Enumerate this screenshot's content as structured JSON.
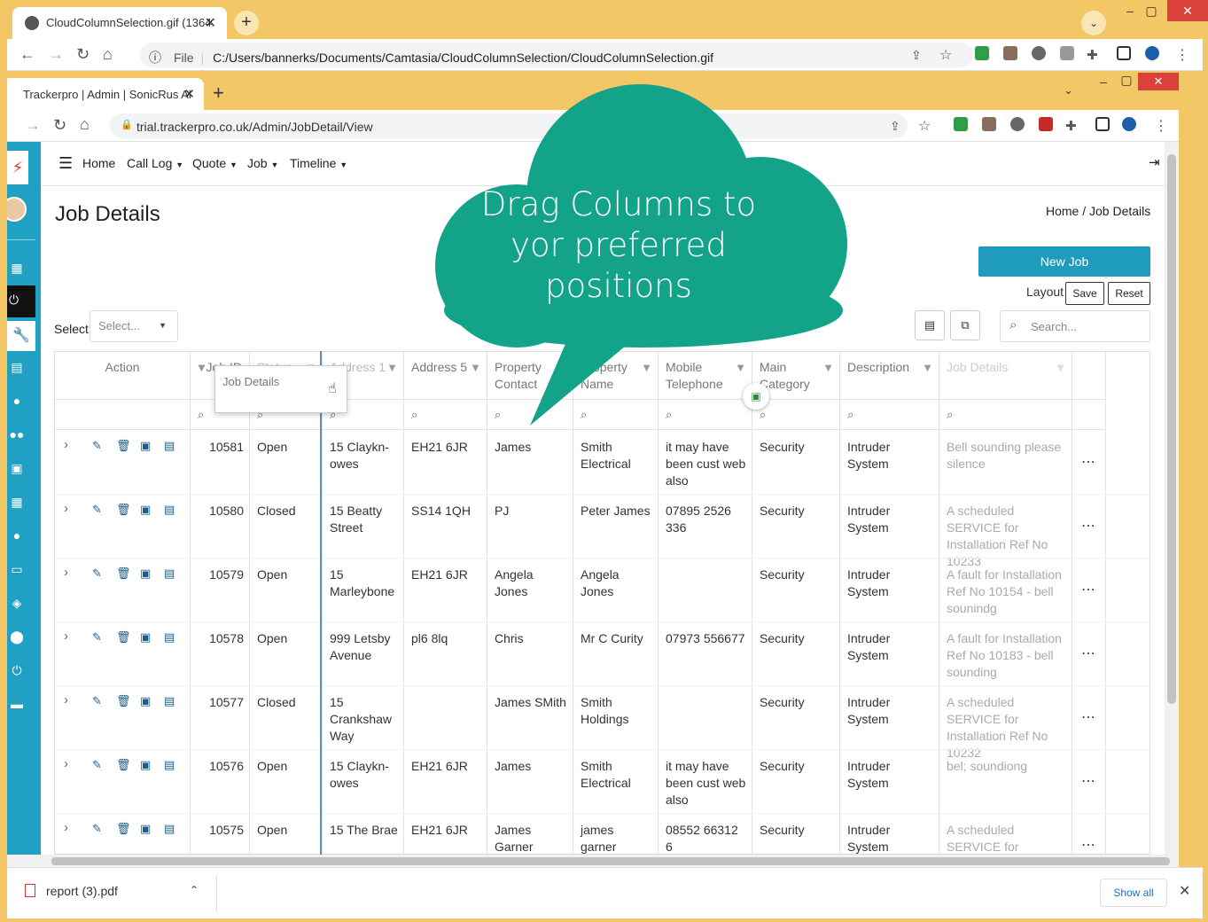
{
  "outer_browser": {
    "tab_title": "CloudColumnSelection.gif (1364",
    "file_label": "File",
    "url": "C:/Users/bannerks/Documents/Camtasia/CloudColumnSelection/CloudColumnSelection.gif"
  },
  "inner_browser": {
    "tab_title": "Trackerpro | Admin | SonicRus Al",
    "url": "trial.trackerpro.co.uk/Admin/JobDetail/View"
  },
  "nav": {
    "home": "Home",
    "call_log": "Call Log",
    "quote": "Quote",
    "job": "Job",
    "timeline": "Timeline"
  },
  "page": {
    "title": "Job Details",
    "breadcrumb": "Home  /  Job Details",
    "new_job": "New Job",
    "layout_label": "Layout",
    "save": "Save",
    "reset": "Reset",
    "select_label": "Select",
    "select_placeholder": "Select...",
    "search_placeholder": "Search..."
  },
  "callout": "Drag Columns to yor preferred positions",
  "drag_ghost": "Job Details",
  "headers": {
    "action": "Action",
    "job_id": "Job ID",
    "status": "Status",
    "address1": "Address 1",
    "address5": "Address 5",
    "property_contact": "Property Contact",
    "property_name": "Property Name",
    "mobile": "Mobile Telephone",
    "main_category": "Main Category",
    "description": "Description",
    "job_details": "Job Details"
  },
  "rows": [
    {
      "id": "10581",
      "status": "Open",
      "address1": "15 Claykn­owes",
      "address5": "EH21 6JR",
      "contact": "James",
      "name": "Smith Electrical",
      "mobile": "it may have been cust web also",
      "category": "Security",
      "description": "Intruder System",
      "details": "Bell sounding please silence"
    },
    {
      "id": "10580",
      "status": "Closed",
      "address1": "15 Beatty Street",
      "address5": "SS14 1QH",
      "contact": "PJ",
      "name": "Peter James",
      "mobile": "07895 2526 336",
      "category": "Security",
      "description": "Intruder System",
      "details": "A scheduled SERVICE for Installation Ref No 10233"
    },
    {
      "id": "10579",
      "status": "Open",
      "address1": "15 Marleybone",
      "address5": "EH21 6JR",
      "contact": "Angela Jones",
      "name": "Angela Jones",
      "mobile": "",
      "category": "Security",
      "description": "Intruder System",
      "details": "A fault for Installation Ref No 10154 - bell sounindg"
    },
    {
      "id": "10578",
      "status": "Open",
      "address1": "999 Letsby Avenue",
      "address5": "pl6 8lq",
      "contact": "Chris",
      "name": "Mr C Curity",
      "mobile": "07973 556677",
      "category": "Security",
      "description": "Intruder System",
      "details": "A fault for Installation Ref No 10183 - bell sounding"
    },
    {
      "id": "10577",
      "status": "Closed",
      "address1": "15 Crankshaw Way",
      "address5": "",
      "contact": "James SMith",
      "name": "Smith Holdings",
      "mobile": "",
      "category": "Security",
      "description": "Intruder System",
      "details": "A scheduled SERVICE for Installation Ref No 10232"
    },
    {
      "id": "10576",
      "status": "Open",
      "address1": "15 Claykn­owes",
      "address5": "EH21 6JR",
      "contact": "James",
      "name": "Smith Electrical",
      "mobile": "it may have been cust web also",
      "category": "Security",
      "description": "Intruder System",
      "details": "bel; soundiong"
    },
    {
      "id": "10575",
      "status": "Open",
      "address1": "15 The Brae",
      "address5": "EH21 6JR",
      "contact": "James Garner",
      "name": "james garner",
      "mobile": "08552 66312 6",
      "category": "Security",
      "description": "Intruder System",
      "details": "A scheduled SERVICE for Installation Ref No"
    }
  ],
  "download": {
    "file": "report (3).pdf",
    "show_all": "Show all"
  }
}
